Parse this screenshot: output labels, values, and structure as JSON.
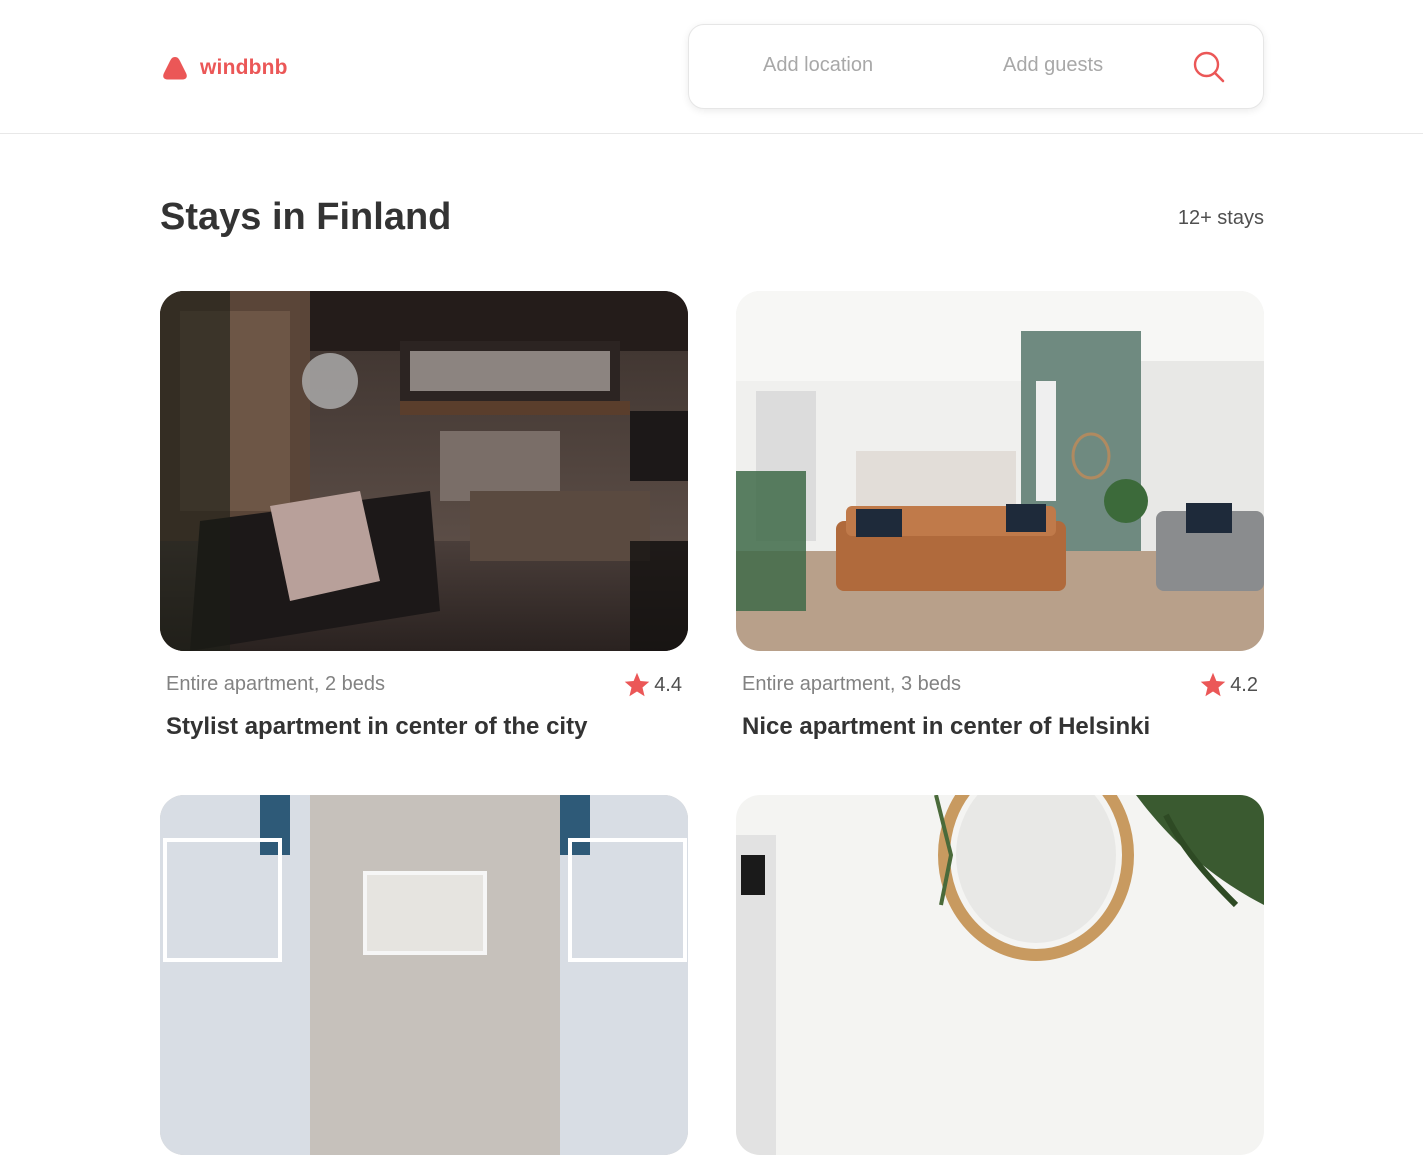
{
  "brand": {
    "name": "windbnb",
    "accent_color": "#eb5757"
  },
  "search": {
    "location_placeholder": "Add location",
    "guests_placeholder": "Add guests",
    "icon": "search-icon"
  },
  "main": {
    "title": "Stays in Finland",
    "count_label": "12+ stays"
  },
  "stays": [
    {
      "type": "Entire apartment, 2 beds",
      "rating": "4.4",
      "title": "Stylist apartment in center of the city",
      "icon": "star-icon"
    },
    {
      "type": "Entire apartment, 3 beds",
      "rating": "4.2",
      "title": "Nice apartment in center of Helsinki",
      "icon": "star-icon"
    },
    {},
    {}
  ]
}
